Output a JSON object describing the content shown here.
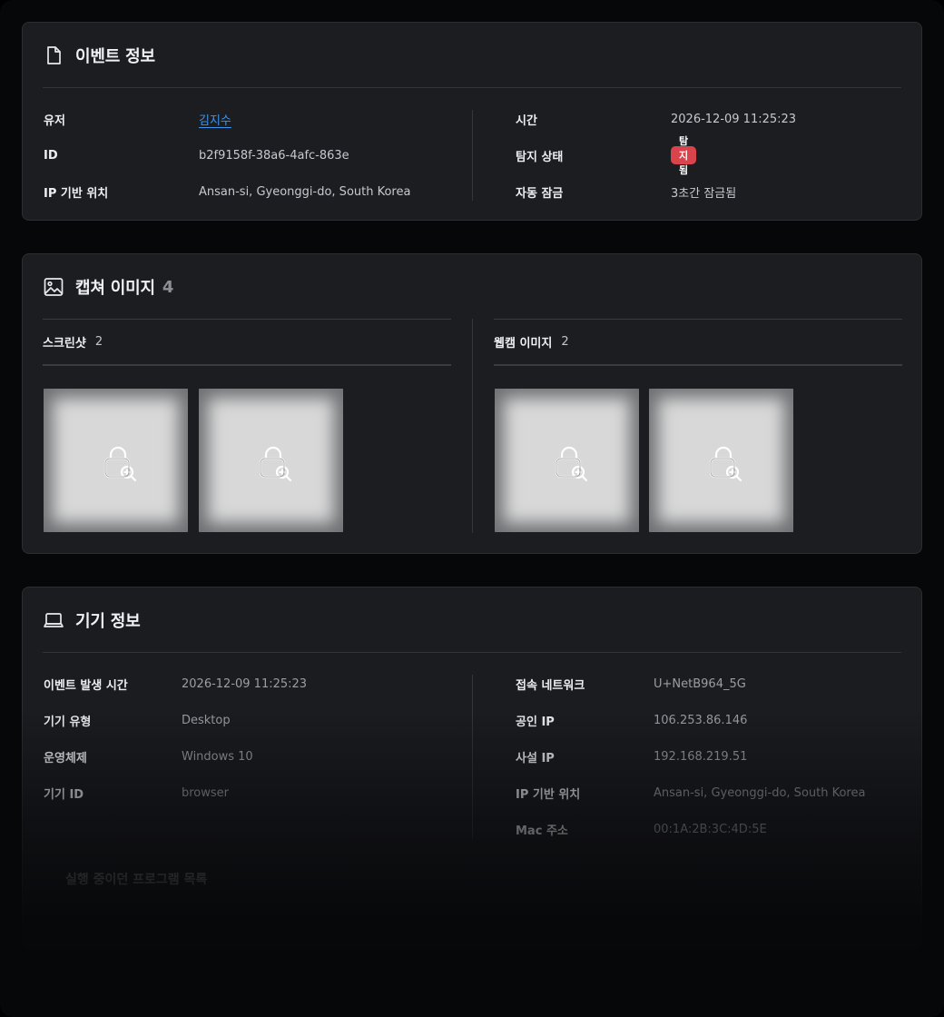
{
  "event_info": {
    "title": "이벤트 정보",
    "icon": "document-icon",
    "left": [
      {
        "key": "유저",
        "value": "김지수",
        "link": true
      },
      {
        "key": "ID",
        "value": "b2f9158f-38a6-4afc-863e"
      },
      {
        "key": "IP 기반 위치",
        "value": "Ansan-si, Gyeonggi-do, South Korea"
      }
    ],
    "right": [
      {
        "key": "시간",
        "value": "2026-12-09 11:25:23"
      },
      {
        "key": "탐지 상태",
        "value": "탐지됨",
        "badge": true,
        "badge_color": "#d9434b"
      },
      {
        "key": "자동 잠금",
        "value": "3초간 잠금됨"
      }
    ]
  },
  "captures": {
    "title": "캡쳐 이미지",
    "count": "4",
    "icon": "image-icon",
    "screenshot": {
      "label": "스크린샷",
      "count": "2",
      "items": [
        "locked-image",
        "locked-image"
      ]
    },
    "webcam": {
      "label": "웹캠 이미지",
      "count": "2",
      "items": [
        "locked-image",
        "locked-image"
      ]
    }
  },
  "device_info": {
    "title": "기기 정보",
    "icon": "laptop-icon",
    "left": [
      {
        "key": "이벤트 발생 시간",
        "value": "2026-12-09 11:25:23"
      },
      {
        "key": "기기 유형",
        "value": "Desktop"
      },
      {
        "key": "운영체제",
        "value": "Windows 10"
      },
      {
        "key": "기기 ID",
        "value": "browser"
      }
    ],
    "right": [
      {
        "key": "접속 네트워크",
        "value": "U+NetB964_5G"
      },
      {
        "key": "공인 IP",
        "value": "106.253.86.146"
      },
      {
        "key": "사설 IP",
        "value": "192.168.219.51"
      },
      {
        "key": "IP 기반 위치",
        "value": "Ansan-si, Gyeonggi-do, South Korea"
      },
      {
        "key": "Mac 주소",
        "value": "00:1A:2B:3C:4D:5E"
      }
    ],
    "programs_title": "실행 중이던 프로그램 목록"
  },
  "colors": {
    "accent_link": "#3c95ef",
    "danger": "#d9434b",
    "card_bg": "#1c1d21",
    "page_bg": "#060709"
  }
}
